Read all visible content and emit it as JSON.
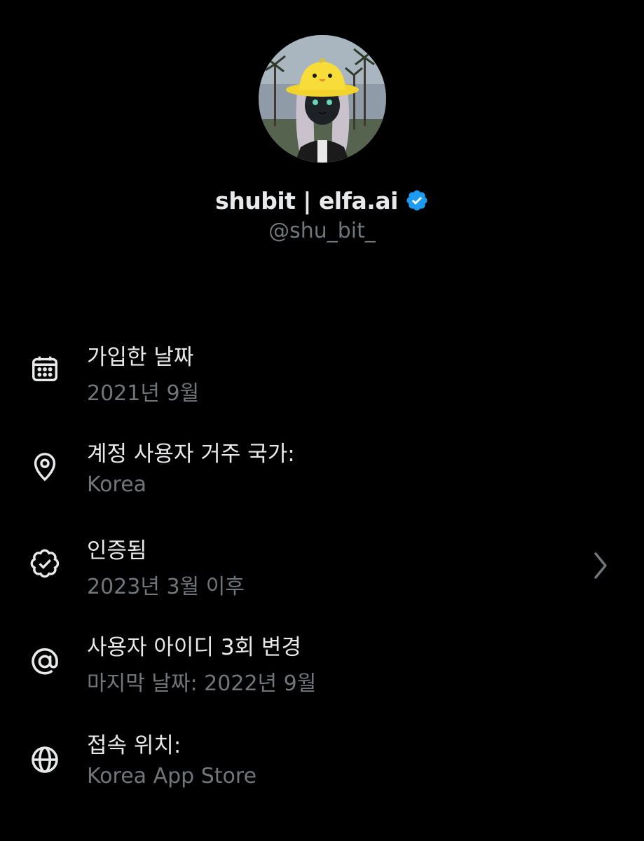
{
  "profile": {
    "avatar_icon": "profile-avatar-duck-hat",
    "display_name": "shubit | elfa.ai",
    "verified_icon": "verified-badge-icon",
    "handle": "@shu_bit_"
  },
  "info": {
    "joined": {
      "icon": "calendar-icon",
      "title": "가입한 날짜",
      "value": "2021년 9월"
    },
    "country": {
      "icon": "location-pin-icon",
      "title": "계정 사용자 거주 국가:",
      "value": "Korea"
    },
    "verified": {
      "icon": "verified-badge-outline-icon",
      "title": "인증됨",
      "value": "2023년 3월 이후"
    },
    "username_changes": {
      "icon": "at-sign-icon",
      "title": "사용자 아이디 3회 변경",
      "value": "마지막 날짜: 2022년 9월"
    },
    "connected_via": {
      "icon": "globe-icon",
      "title": "접속 위치:",
      "value": "Korea App Store"
    }
  },
  "colors": {
    "background": "#000000",
    "primary_text": "#e7e9ea",
    "secondary_text": "#71767b",
    "verified_blue": "#1d9bf0"
  }
}
